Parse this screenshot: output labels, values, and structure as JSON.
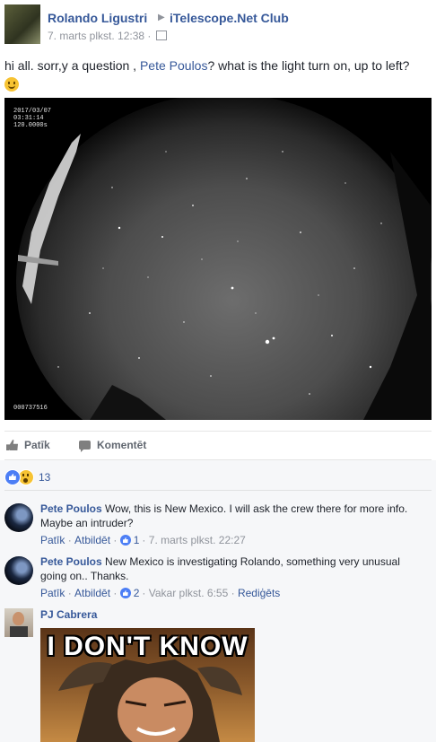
{
  "post": {
    "author": "Rolando Ligustri",
    "group": "iTelescope.Net Club",
    "timestamp": "7. marts plkst. 12:38 ·",
    "text_before": "hi all. sorr,y a question , ",
    "mention": "Pete Poulos",
    "text_after": "? what is the light turn on, up to left?",
    "photo": {
      "stamp_date": "2017/03/07",
      "stamp_time": "03:31:14",
      "stamp_exposure": "120.0000s",
      "stamp_id": "000737516"
    }
  },
  "actions": {
    "like": "Patīk",
    "comment": "Komentēt"
  },
  "reactions": {
    "count": "13"
  },
  "comments": [
    {
      "author": "Pete Poulos",
      "text": "Wow, this is New Mexico. I will ask the crew there for more info. Maybe an intruder?",
      "like": "Patīk",
      "reply": "Atbildēt",
      "likes": "1",
      "time": "7. marts plkst. 22:27"
    },
    {
      "author": "Pete Poulos",
      "text": "New Mexico is investigating Rolando, something very unusual going on.. Thanks.",
      "like": "Patīk",
      "reply": "Atbildēt",
      "likes": "2",
      "time": "Vakar plkst. 6:55",
      "edited": "Rediģēts"
    }
  ],
  "reply3": {
    "author": "PJ Cabrera",
    "meme_text": "I DON'T KNOW"
  },
  "colors": {
    "link": "#365899",
    "meta": "#90949c",
    "comments_bg": "#f6f7f9"
  }
}
